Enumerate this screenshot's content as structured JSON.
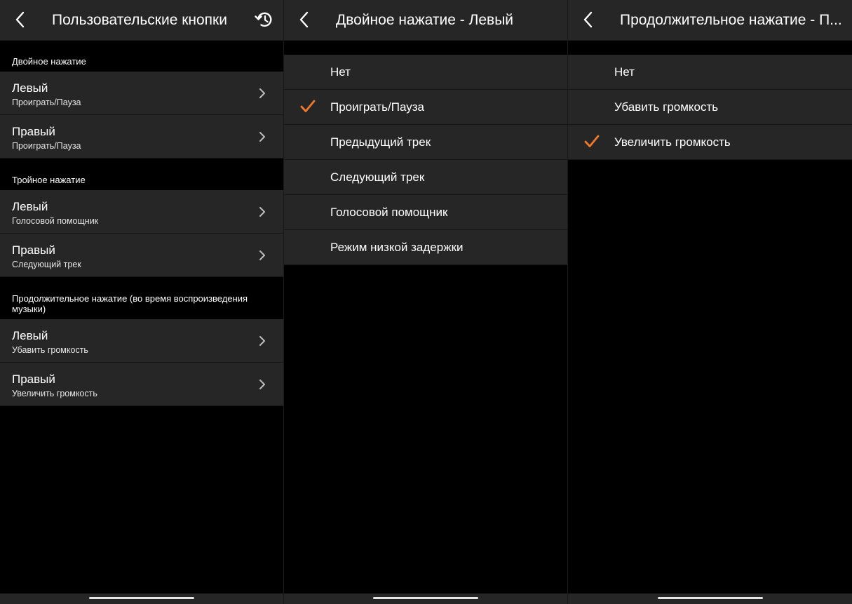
{
  "colors": {
    "background": "#000000",
    "surface": "#262626",
    "accent": "#f07a2c",
    "text": "#ffffff"
  },
  "screen1": {
    "title": "Пользовательские кнопки",
    "back_icon": "chevron-left-icon",
    "reset_icon": "reset-icon",
    "sections": [
      {
        "title": "Двойное нажатие",
        "items": [
          {
            "label": "Левый",
            "value": "Проиграть/Пауза"
          },
          {
            "label": "Правый",
            "value": "Проиграть/Пауза"
          }
        ]
      },
      {
        "title": "Тройное нажатие",
        "items": [
          {
            "label": "Левый",
            "value": "Голосовой помощник"
          },
          {
            "label": "Правый",
            "value": "Следующий трек"
          }
        ]
      },
      {
        "title": "Продолжительное нажатие (во время воспроизведения музыки)",
        "items": [
          {
            "label": "Левый",
            "value": "Убавить громкость"
          },
          {
            "label": "Правый",
            "value": "Увеличить громкость"
          }
        ]
      }
    ]
  },
  "screen2": {
    "title": "Двойное нажатие - Левый",
    "back_icon": "chevron-left-icon",
    "options": [
      {
        "label": "Нет",
        "selected": false
      },
      {
        "label": "Проиграть/Пауза",
        "selected": true
      },
      {
        "label": "Предыдущий трек",
        "selected": false
      },
      {
        "label": "Следующий трек",
        "selected": false
      },
      {
        "label": "Голосовой помощник",
        "selected": false
      },
      {
        "label": "Режим низкой задержки",
        "selected": false
      }
    ]
  },
  "screen3": {
    "title": "Продолжительное нажатие - П...",
    "back_icon": "chevron-left-icon",
    "options": [
      {
        "label": "Нет",
        "selected": false
      },
      {
        "label": "Убавить громкость",
        "selected": false
      },
      {
        "label": "Увеличить громкость",
        "selected": true
      }
    ]
  }
}
